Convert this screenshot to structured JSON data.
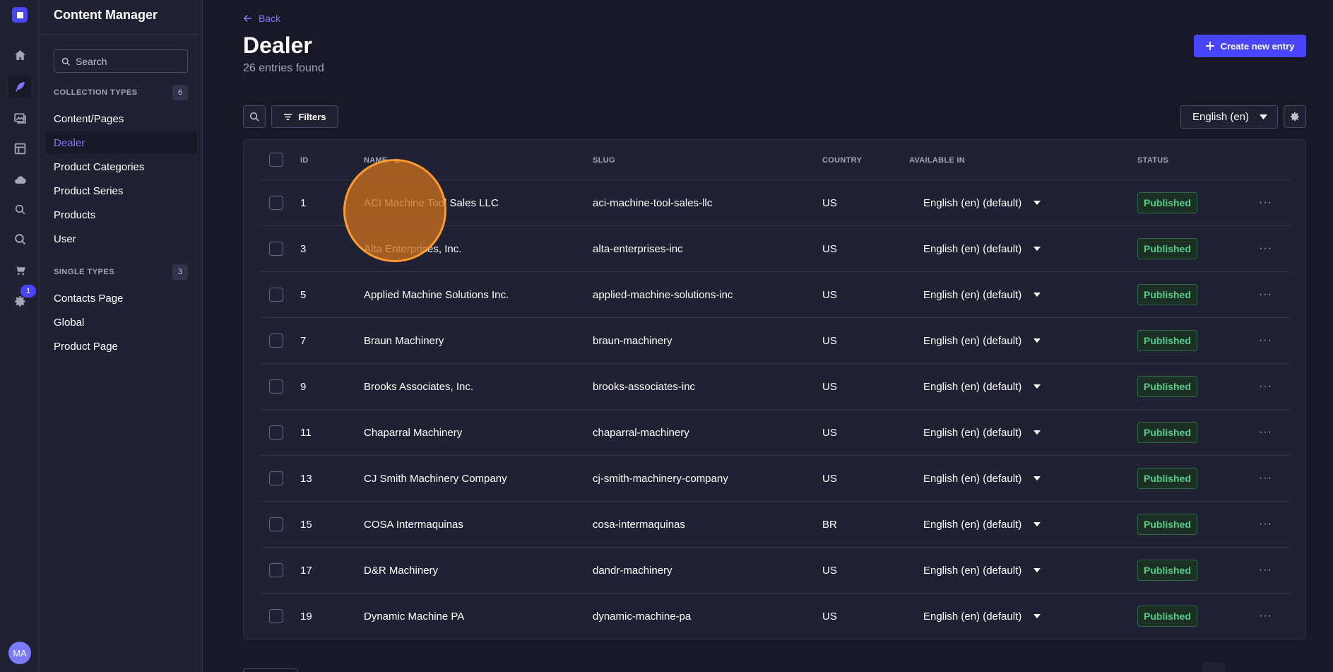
{
  "rail": {
    "items": [
      {
        "name": "home-icon",
        "active": false
      },
      {
        "name": "content-manager-icon",
        "active": true
      },
      {
        "name": "media-library-icon",
        "active": false
      },
      {
        "name": "content-type-builder-icon",
        "active": false
      },
      {
        "name": "cloud-icon",
        "active": false
      },
      {
        "name": "seo-icon",
        "active": false
      },
      {
        "name": "search-icon",
        "active": false
      },
      {
        "name": "cart-icon",
        "active": false
      },
      {
        "name": "settings-icon",
        "active": false
      }
    ],
    "settings_badge": "1",
    "avatar_initials": "MA"
  },
  "subnav": {
    "title": "Content Manager",
    "search_placeholder": "Search",
    "collection_label": "COLLECTION TYPES",
    "collection_count": "6",
    "collection_items": [
      "Content/Pages",
      "Dealer",
      "Product Categories",
      "Product Series",
      "Products",
      "User"
    ],
    "active_item": "Dealer",
    "single_label": "SINGLE TYPES",
    "single_count": "3",
    "single_items": [
      "Contacts Page",
      "Global",
      "Product Page"
    ]
  },
  "header": {
    "back_label": "Back",
    "title": "Dealer",
    "subtitle": "26 entries found",
    "create_label": "Create new entry"
  },
  "toolbar": {
    "filters_label": "Filters",
    "locale": "English (en)"
  },
  "table": {
    "columns": {
      "id": "ID",
      "name": "NAME",
      "slug": "SLUG",
      "country": "COUNTRY",
      "available_in": "AVAILABLE IN",
      "status": "STATUS"
    },
    "rows": [
      {
        "id": "1",
        "name": "ACI Machine Tool Sales LLC",
        "slug": "aci-machine-tool-sales-llc",
        "country": "US",
        "available_in": "English (en) (default)",
        "status": "Published"
      },
      {
        "id": "3",
        "name": "Alta Enterprises, Inc.",
        "slug": "alta-enterprises-inc",
        "country": "US",
        "available_in": "English (en) (default)",
        "status": "Published"
      },
      {
        "id": "5",
        "name": "Applied Machine Solutions Inc.",
        "slug": "applied-machine-solutions-inc",
        "country": "US",
        "available_in": "English (en) (default)",
        "status": "Published"
      },
      {
        "id": "7",
        "name": "Braun Machinery",
        "slug": "braun-machinery",
        "country": "US",
        "available_in": "English (en) (default)",
        "status": "Published"
      },
      {
        "id": "9",
        "name": "Brooks Associates, Inc.",
        "slug": "brooks-associates-inc",
        "country": "US",
        "available_in": "English (en) (default)",
        "status": "Published"
      },
      {
        "id": "11",
        "name": "Chaparral Machinery",
        "slug": "chaparral-machinery",
        "country": "US",
        "available_in": "English (en) (default)",
        "status": "Published"
      },
      {
        "id": "13",
        "name": "CJ Smith Machinery Company",
        "slug": "cj-smith-machinery-company",
        "country": "US",
        "available_in": "English (en) (default)",
        "status": "Published"
      },
      {
        "id": "15",
        "name": "COSA Intermaquinas",
        "slug": "cosa-intermaquinas",
        "country": "BR",
        "available_in": "English (en) (default)",
        "status": "Published"
      },
      {
        "id": "17",
        "name": "D&R Machinery",
        "slug": "dandr-machinery",
        "country": "US",
        "available_in": "English (en) (default)",
        "status": "Published"
      },
      {
        "id": "19",
        "name": "Dynamic Machine PA",
        "slug": "dynamic-machine-pa",
        "country": "US",
        "available_in": "English (en) (default)",
        "status": "Published"
      }
    ]
  },
  "colors": {
    "accent": "#4945ff",
    "accent_text": "#7b79ff",
    "published": "#55cb8a",
    "click_marker": "#ff9a2e"
  }
}
